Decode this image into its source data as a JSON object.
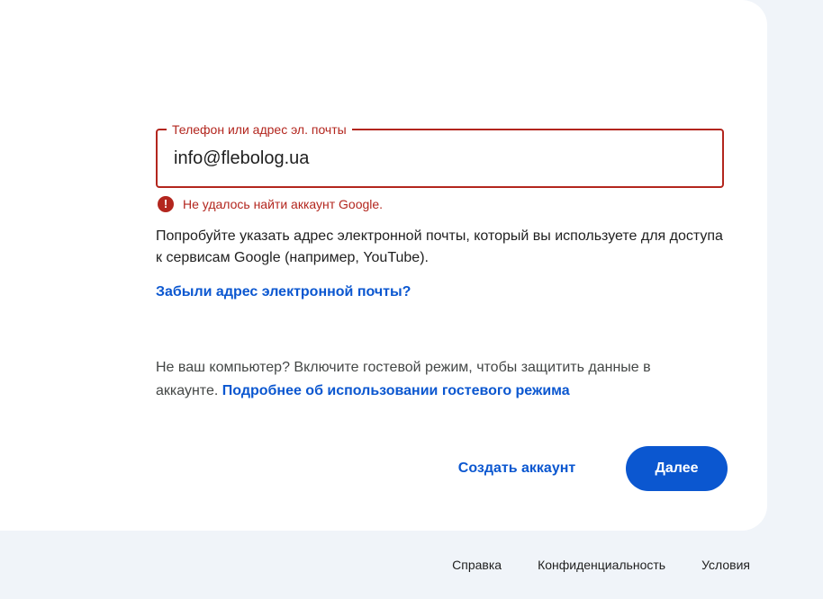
{
  "form": {
    "field_label": "Телефон или адрес эл. почты",
    "field_value": "info@flebolog.ua",
    "error_icon": "!",
    "error_message": "Не удалось найти аккаунт Google.",
    "hint": "Попробуйте указать адрес электронной почты, который вы используете для доступа к сервисам Google (например, YouTube).",
    "forgot_link": "Забыли адрес электронной почты?",
    "guest_text": "Не ваш компьютер? Включите гостевой режим, чтобы защитить данные в аккаунте.",
    "guest_link": "Подробнее об использовании гостевого режима",
    "create_account_label": "Создать аккаунт",
    "next_label": "Далее"
  },
  "footer": {
    "help": "Справка",
    "privacy": "Конфиденциальность",
    "terms": "Условия"
  },
  "colors": {
    "error": "#b3261e",
    "accent": "#0b57d0",
    "background": "#f0f4f9"
  },
  "icons": {
    "error": "error-circle-icon"
  }
}
